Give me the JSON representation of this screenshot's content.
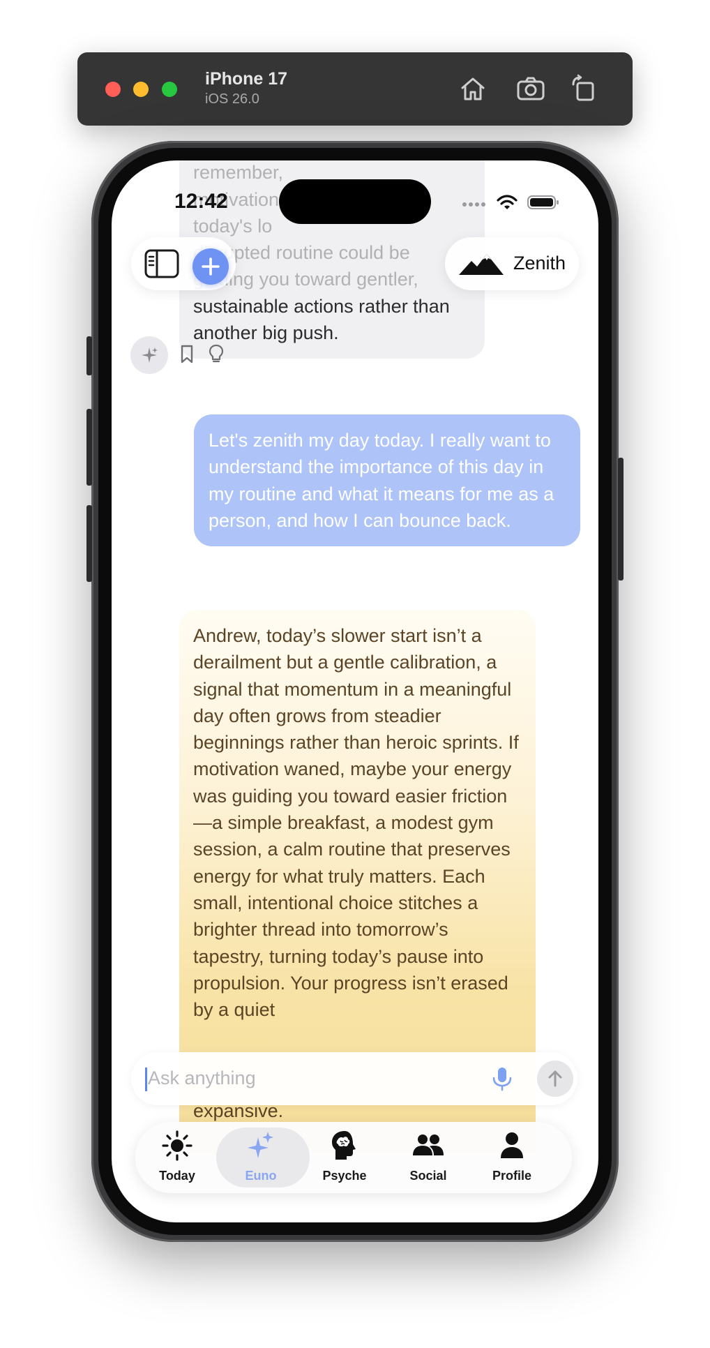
{
  "simulator": {
    "device_name": "iPhone 17",
    "os_version": "iOS 26.0",
    "toolbar_icons": [
      "home-icon",
      "screenshot-icon",
      "rotate-icon"
    ]
  },
  "status_bar": {
    "time": "12:42"
  },
  "header": {
    "brand_label": "Zenith"
  },
  "messages": {
    "previous_ai": {
      "lines_faded": [
        "bigger tasks later. And remember,",
        "motivation",
        "today's lo",
        "disrupted routine could be",
        "guiding you toward gentler,"
      ],
      "lines": [
        "sustainable actions rather than",
        "another big push."
      ]
    },
    "user": "Let's zenith my day today. I really want to understand the importance of this day in my routine and what it means for me as a person, and how I can bounce back.",
    "ai": "Andrew, today’s slower start isn’t a derailment but a gentle calibration, a signal that momentum in a meaningful day often grows from steadier beginnings rather than heroic sprints. If motivation waned, maybe your energy was guiding you toward easier friction—a simple breakfast, a modest gym session, a calm routine that preserves energy for what truly matters. Each small, intentional choice stitches a brighter thread into tomorrow’s tapestry, turning today’s pause into propulsion. Your progress isn’t erased by a quiet",
    "ai_tail": "expansive."
  },
  "input": {
    "placeholder": "Ask anything"
  },
  "tabs": [
    {
      "label": "Today",
      "icon": "sun-icon"
    },
    {
      "label": "Euno",
      "icon": "sparkles-icon"
    },
    {
      "label": "Psyche",
      "icon": "brain-head-icon"
    },
    {
      "label": "Social",
      "icon": "people-icon"
    },
    {
      "label": "Profile",
      "icon": "person-icon"
    }
  ],
  "active_tab": "Euno",
  "colors": {
    "accent": "#6e93f2",
    "user_bubble": "#aec3f7",
    "ai_bubble_warm": "#f6de9b",
    "active_tab_label": "#8aa6f1"
  }
}
